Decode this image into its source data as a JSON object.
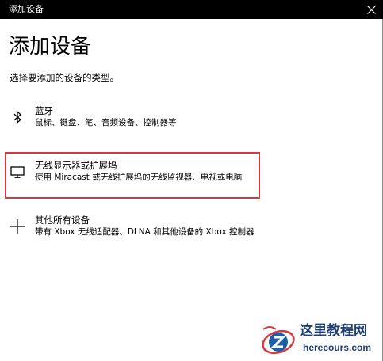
{
  "window": {
    "title": "添加设备"
  },
  "page": {
    "heading": "添加设备",
    "subheading": "选择要添加的设备的类型。"
  },
  "options": [
    {
      "name": "蓝牙",
      "description": "鼠标、键盘、笔、音频设备、控制器等",
      "icon": "bluetooth-icon"
    },
    {
      "name": "无线显示器或扩展坞",
      "description": "使用 Miracast 或无线扩展坞的无线监视器、电视或电脑",
      "icon": "monitor-icon",
      "highlighted": true
    },
    {
      "name": "其他所有设备",
      "description": "带有 Xbox 无线适配器、DLNA 和其他设备的 Xbox 控制器",
      "icon": "plus-icon"
    }
  ],
  "watermark": {
    "title": "这里教程网",
    "url": "herecours.com"
  },
  "colors": {
    "titlebar": "#000000",
    "highlight_border": "#d9363e",
    "watermark_text": "#1d3f73"
  }
}
